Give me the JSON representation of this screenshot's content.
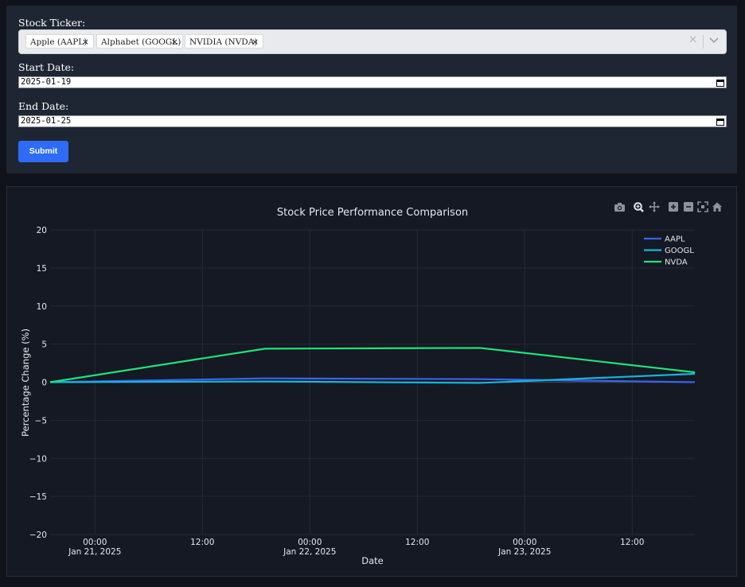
{
  "form": {
    "ticker_label": "Stock Ticker:",
    "selected_tickers": [
      {
        "label": "Apple (AAPL)"
      },
      {
        "label": "Alphabet (GOOGL)"
      },
      {
        "label": "NVIDIA (NVDA)"
      }
    ],
    "chip_remove_glyph": "×",
    "clear_glyph": "✕",
    "start_label": "Start Date:",
    "start_value": "2025-01-19",
    "end_label": "End Date:",
    "end_value": "2025-01-25",
    "submit_label": "Submit"
  },
  "toolbar": {
    "icons": [
      "camera-icon",
      "zoom-icon",
      "pan-icon",
      "zoom-in-icon",
      "zoom-out-icon",
      "autoscale-icon",
      "reset-axes-icon"
    ]
  },
  "chart_data": {
    "type": "line",
    "title": "Stock Price Performance Comparison",
    "xlabel": "Date",
    "ylabel": "Percentage Change (%)",
    "ylim": [
      -20,
      20
    ],
    "yticks": [
      20,
      15,
      10,
      5,
      0,
      -5,
      -10,
      -15,
      -20
    ],
    "xlim": [
      "2025-01-20 19:00",
      "2025-01-23 19:00"
    ],
    "xticks": [
      {
        "t": "2025-01-21 00:00",
        "line1": "00:00",
        "line2": "Jan 21, 2025"
      },
      {
        "t": "2025-01-21 12:00",
        "line1": "12:00",
        "line2": ""
      },
      {
        "t": "2025-01-22 00:00",
        "line1": "00:00",
        "line2": "Jan 22, 2025"
      },
      {
        "t": "2025-01-22 12:00",
        "line1": "12:00",
        "line2": ""
      },
      {
        "t": "2025-01-23 00:00",
        "line1": "00:00",
        "line2": "Jan 23, 2025"
      },
      {
        "t": "2025-01-23 12:00",
        "line1": "12:00",
        "line2": ""
      }
    ],
    "x": [
      "2025-01-20 19:00",
      "2025-01-21 19:00",
      "2025-01-22 19:00",
      "2025-01-23 19:00"
    ],
    "series": [
      {
        "name": "AAPL",
        "color": "#3a63f0",
        "values": [
          0,
          0.5,
          0.4,
          0.0
        ]
      },
      {
        "name": "GOOGL",
        "color": "#18b4dc",
        "values": [
          0,
          0.1,
          -0.1,
          1.1
        ]
      },
      {
        "name": "NVDA",
        "color": "#1ee47a",
        "values": [
          0,
          4.4,
          4.5,
          1.3
        ]
      }
    ],
    "legend_position": "top-right",
    "grid": true
  }
}
